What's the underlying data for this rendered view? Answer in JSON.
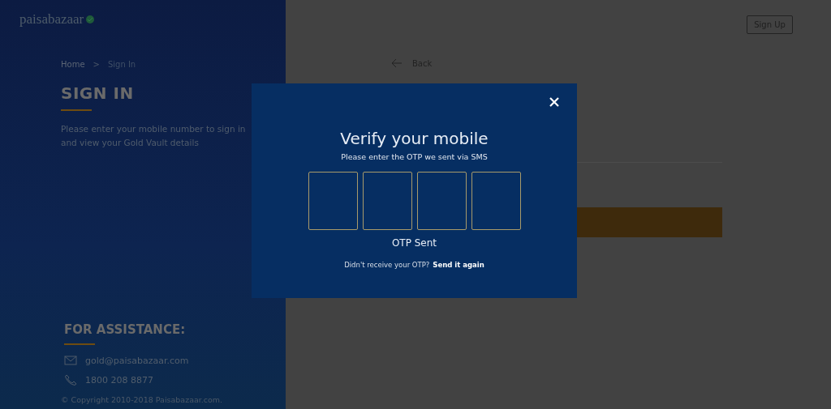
{
  "header": {
    "logo": "paisabazaar",
    "signup_button": "Sign Up"
  },
  "breadcrumb": [
    {
      "label": "Home",
      "selected": false
    },
    {
      "label": "Sign In",
      "selected": true
    }
  ],
  "breadcrumb_separator": ">",
  "heading": "SIGN IN",
  "intro": "Please enter your mobile number to sign in and view your Gold Vault details",
  "back_link": "Back",
  "assistance": {
    "title": "FOR ASSISTANCE:",
    "contacts": [
      {
        "kind": "email",
        "text": "gold@paisabazaar.com"
      },
      {
        "kind": "phone",
        "text": "1800 208 8877"
      }
    ]
  },
  "copyright": "© Copyright 2010-2018 Paisabazaar.com.",
  "modal": {
    "title": "Verify your mobile",
    "subtitle": "Please enter the OTP we sent via SMS",
    "status": "OTP Sent",
    "resend_prompt": "Didn't receive your OTP?",
    "resend_link": "Send it again"
  }
}
